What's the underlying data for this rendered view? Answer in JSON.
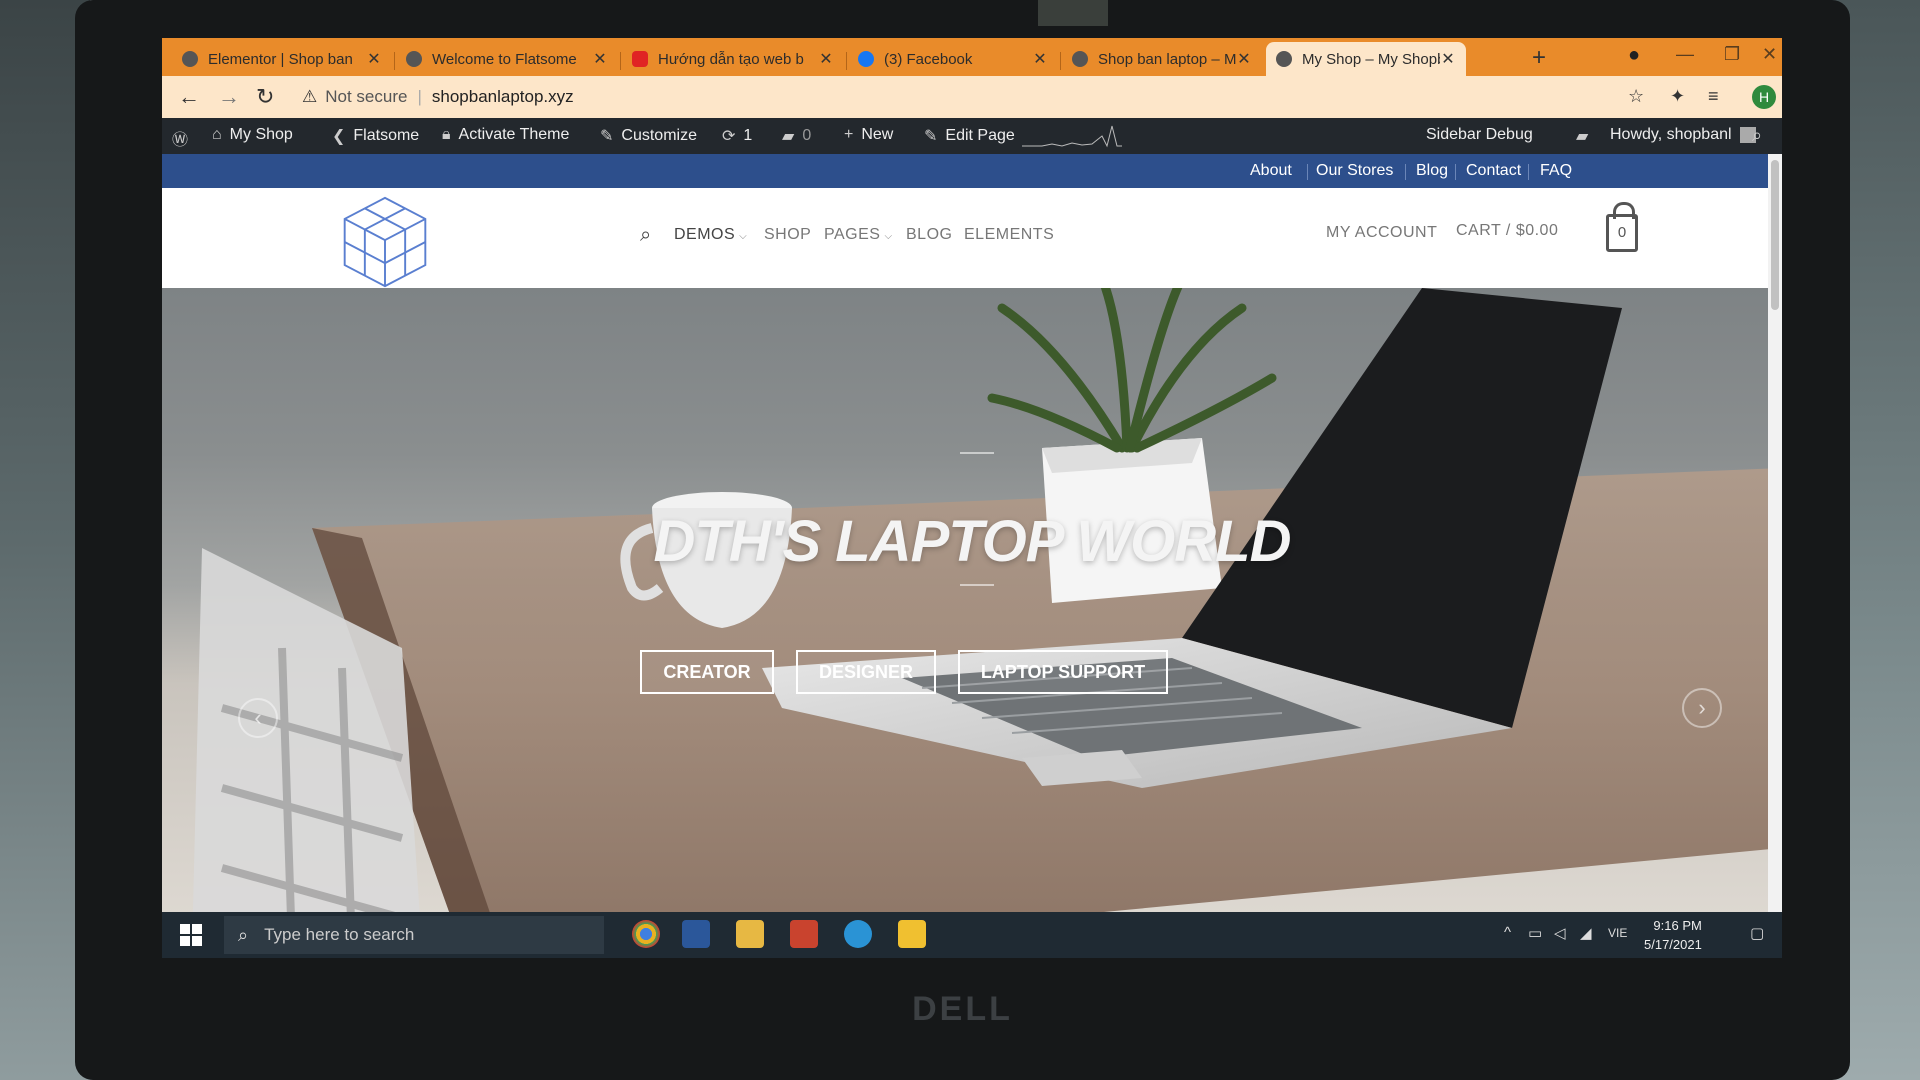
{
  "browser": {
    "tabs": [
      {
        "title": "Elementor | Shop ban",
        "active": false
      },
      {
        "title": "Welcome to Flatsome",
        "active": false
      },
      {
        "title": "Hướng dẫn tạo web b",
        "active": false
      },
      {
        "title": "(3) Facebook",
        "active": false
      },
      {
        "title": "Shop ban laptop – My",
        "active": false
      },
      {
        "title": "My Shop – My Shopb",
        "active": true
      }
    ],
    "security_label": "Not secure",
    "url": "shopbanlaptop.xyz",
    "profile_initial": "H"
  },
  "admin_bar": {
    "my_shop": "My Shop",
    "flatsome": "Flatsome",
    "activate_theme": "Activate Theme",
    "customize": "Customize",
    "updates_count": "1",
    "comments_count": "0",
    "new": "New",
    "edit_page": "Edit Page",
    "sidebar_debug": "Sidebar Debug",
    "howdy": "Howdy, shopbanl"
  },
  "top_nav": [
    "About",
    "Our Stores",
    "Blog",
    "Contact",
    "FAQ"
  ],
  "main_nav": {
    "demos": "DEMOS",
    "shop": "SHOP",
    "pages": "PAGES",
    "blog": "BLOG",
    "elements": "ELEMENTS",
    "my_account": "MY ACCOUNT",
    "cart": "CART / $0.00",
    "cart_count": "0"
  },
  "hero": {
    "title": "DTH'S LAPTOP WORLD",
    "buttons": [
      "CREATOR",
      "DESIGNER",
      "LAPTOP SUPPORT"
    ]
  },
  "taskbar": {
    "search_placeholder": "Type here to search",
    "time": "9:16 PM",
    "date": "5/17/2021",
    "lang": "VIE"
  },
  "device_brand": "DELL",
  "colors": {
    "tab_strip": "#e98b2a",
    "toolbar": "#fde6c9",
    "wp_admin_bar": "#23282d",
    "top_bar": "#2d4f8c",
    "logo_blue": "#5a7fd0"
  }
}
